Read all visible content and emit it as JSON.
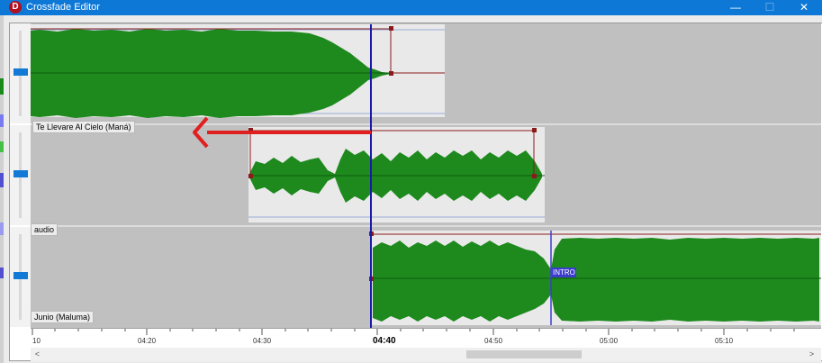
{
  "window": {
    "title": "Crossfade Editor",
    "app_icon_letter": "D",
    "minimize_glyph": "—",
    "maximize_glyph": "☐",
    "close_glyph": "✕"
  },
  "tracks": [
    {
      "label": "Te Llevare Al Cielo (Maná)"
    },
    {
      "label": "audio"
    },
    {
      "label": "Junio (Maluma)"
    }
  ],
  "markers": {
    "intro_label": "INTRO"
  },
  "timeline": {
    "ticks": [
      "10",
      "04:20",
      "04:30",
      "04:40",
      "04:50",
      "05:00",
      "05:10"
    ],
    "playhead_time": "04:40"
  },
  "scrollbar": {
    "left_arrow": "<",
    "right_arrow": ">"
  },
  "colors": {
    "titlebar": "#0e78d7",
    "waveform": "#1e8a1e",
    "clip_bg": "#e9e9e9",
    "lane_bg": "#c0c0c0",
    "envelope": "#8b1a1a",
    "playhead": "#1a1aa8",
    "annotation_arrow": "#e02020",
    "marker": "#3c3ccf"
  }
}
